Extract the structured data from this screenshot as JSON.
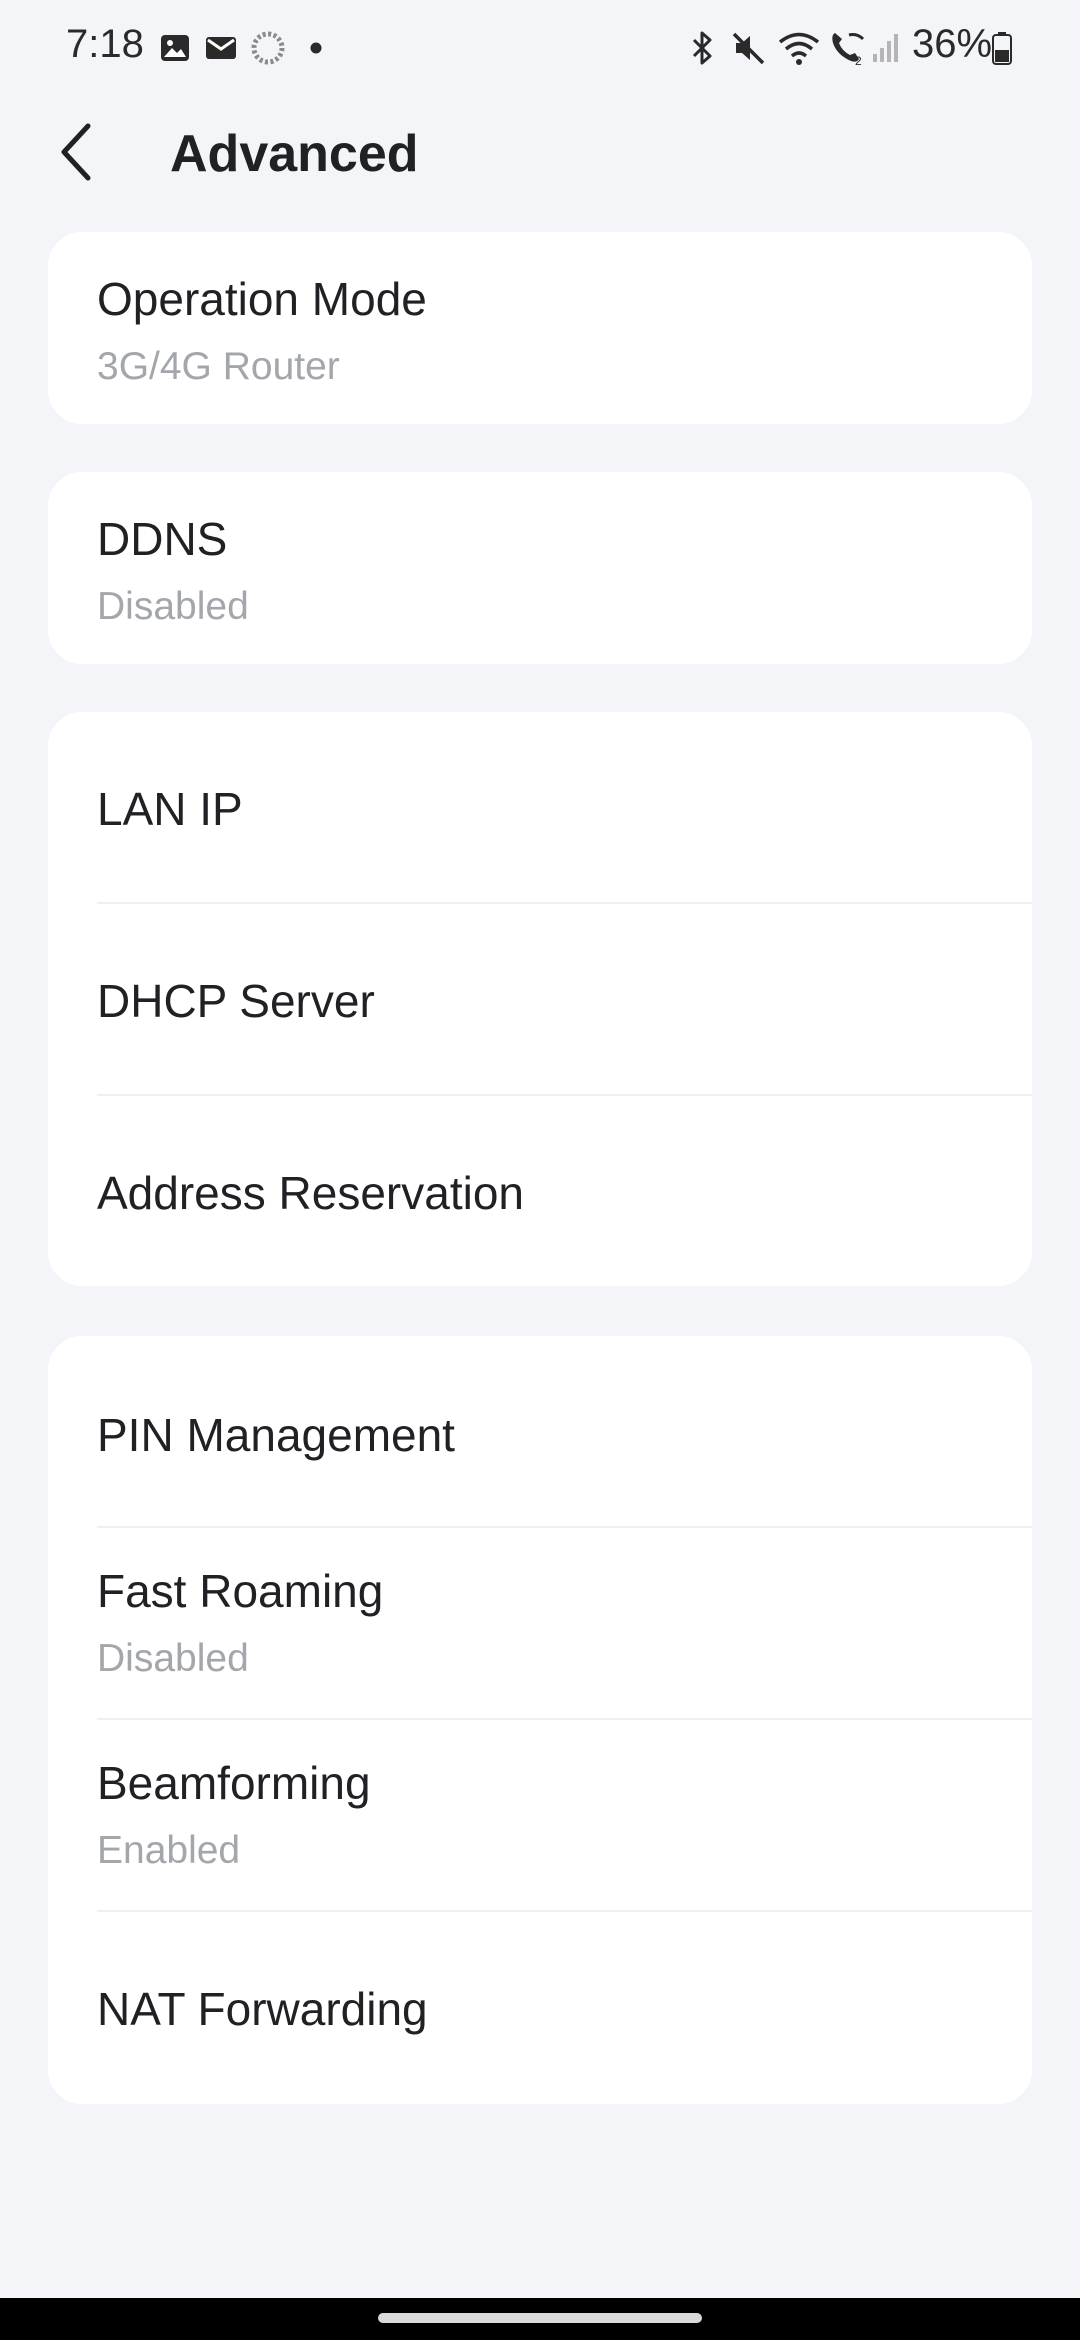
{
  "status_bar": {
    "time": "7:18",
    "battery": "36%",
    "icons_left": [
      "gallery-icon",
      "mail-icon",
      "sync-icon",
      "dot-icon"
    ],
    "icons_right": [
      "bluetooth-icon",
      "mute-icon",
      "wifi-icon",
      "wifi-calling-icon",
      "signal-icon",
      "battery-icon"
    ]
  },
  "header": {
    "title": "Advanced",
    "back_icon": "chevron-left-icon"
  },
  "cards": [
    {
      "items": [
        {
          "label": "Operation Mode",
          "value": "3G/4G Router"
        }
      ]
    },
    {
      "items": [
        {
          "label": "DDNS",
          "value": "Disabled"
        }
      ]
    },
    {
      "items": [
        {
          "label": "LAN IP"
        },
        {
          "label": "DHCP Server"
        },
        {
          "label": "Address Reservation"
        }
      ]
    },
    {
      "items": [
        {
          "label": "PIN Management"
        },
        {
          "label": "Fast Roaming",
          "value": "Disabled"
        },
        {
          "label": "Beamforming",
          "value": "Enabled"
        },
        {
          "label": "NAT Forwarding"
        }
      ]
    }
  ],
  "colors": {
    "background": "#f4f5f9",
    "card": "#ffffff",
    "primary_text": "#1f2124",
    "secondary_text": "#a3a6ab"
  }
}
